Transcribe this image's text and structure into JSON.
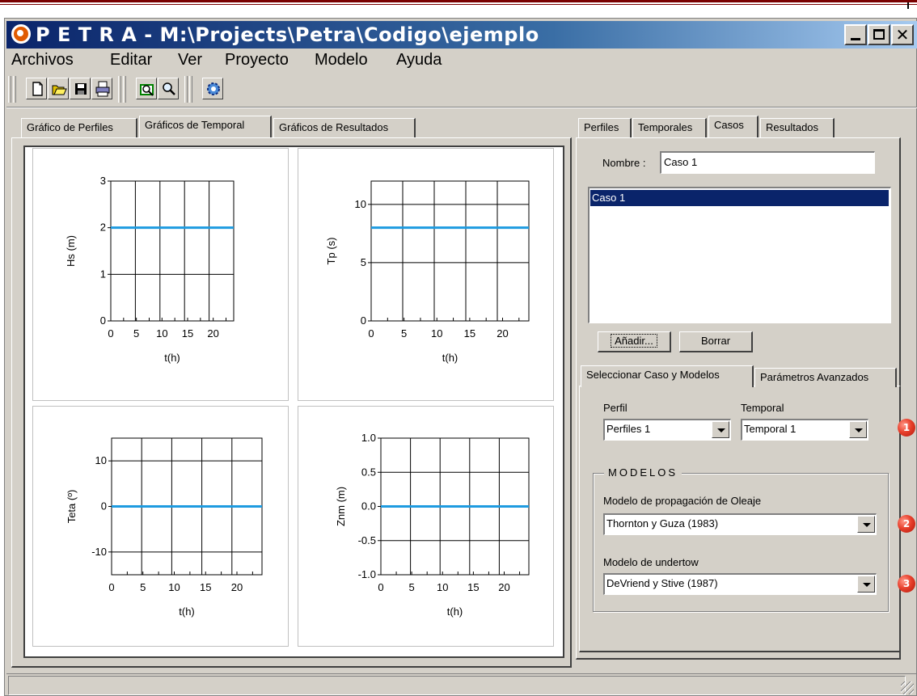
{
  "window": {
    "title": "P E T R A - M:\\Projects\\Petra\\Codigo\\ejemplo",
    "minimize_icon": "minimize-icon",
    "maximize_icon": "maximize-icon",
    "close_glyph": "✕"
  },
  "menu": [
    "Archivos",
    "Editar",
    "Ver",
    "Proyecto",
    "Modelo",
    "Ayuda"
  ],
  "toolbar": {
    "icons": [
      "new-file-icon",
      "open-folder-icon",
      "save-icon",
      "print-icon",
      "zoom-window-icon",
      "zoom-icon",
      "run-gear-icon"
    ]
  },
  "left_tabs": [
    "Gráfico de Perfiles",
    "Gráficos de Temporal",
    "Gráficos de Resultados"
  ],
  "left_active_tab": 1,
  "right_tabs": [
    "Perfiles",
    "Temporales",
    "Casos",
    "Resultados"
  ],
  "right_active_tab": 2,
  "casos": {
    "nombre_label": "Nombre :",
    "nombre_value": "Caso 1",
    "list": [
      "Caso 1"
    ],
    "selected": 0,
    "add_button": "Añadir...",
    "delete_button": "Borrar"
  },
  "sub_tabs": [
    "Seleccionar Caso y Modelos",
    "Parámetros Avanzados"
  ],
  "sub_active_tab": 0,
  "selection": {
    "perfil_label": "Perfil",
    "perfil_value": "Perfiles 1",
    "temporal_label": "Temporal",
    "temporal_value": "Temporal 1"
  },
  "modelos": {
    "group_label": "MODELOS",
    "oleaje_label": "Modelo de propagación de Oleaje",
    "oleaje_value": "Thornton y Guza (1983)",
    "undertow_label": "Modelo de undertow",
    "undertow_value": "DeVriend y Stive (1987)"
  },
  "badges": [
    "1",
    "2",
    "3"
  ],
  "colors": {
    "series": "#1e9be0",
    "selection": "#0a246a",
    "badge": "#e8402c"
  },
  "chart_data": [
    {
      "type": "line",
      "xlabel": "t(h)",
      "ylabel": "Hs (m)",
      "xlim": [
        0,
        24
      ],
      "ylim": [
        0,
        3
      ],
      "xticks": [
        0,
        5,
        10,
        15,
        20
      ],
      "yticks": [
        0,
        1,
        2,
        3
      ],
      "series": [
        {
          "x": [
            0,
            24
          ],
          "y": [
            2,
            2
          ]
        }
      ]
    },
    {
      "type": "line",
      "xlabel": "t(h)",
      "ylabel": "Tp (s)",
      "xlim": [
        0,
        24
      ],
      "ylim": [
        0,
        12
      ],
      "xticks": [
        0,
        5,
        10,
        15,
        20
      ],
      "yticks": [
        0,
        5,
        10
      ],
      "series": [
        {
          "x": [
            0,
            24
          ],
          "y": [
            8,
            8
          ]
        }
      ]
    },
    {
      "type": "line",
      "xlabel": "t(h)",
      "ylabel": "Teta (º)",
      "xlim": [
        0,
        24
      ],
      "ylim": [
        -15,
        15
      ],
      "xticks": [
        0,
        5,
        10,
        15,
        20
      ],
      "yticks": [
        -10,
        0,
        10
      ],
      "series": [
        {
          "x": [
            0,
            24
          ],
          "y": [
            0,
            0
          ]
        }
      ]
    },
    {
      "type": "line",
      "xlabel": "t(h)",
      "ylabel": "Znm (m)",
      "xlim": [
        0,
        24
      ],
      "ylim": [
        -1,
        1
      ],
      "xticks": [
        0,
        5,
        10,
        15,
        20
      ],
      "yticks": [
        -1.0,
        -0.5,
        0.0,
        0.5,
        1.0
      ],
      "ytick_labels": [
        "-1.0",
        "-0.5",
        "0.0",
        "0.5",
        "1.0"
      ],
      "series": [
        {
          "x": [
            0,
            24
          ],
          "y": [
            0,
            0
          ]
        }
      ]
    }
  ]
}
